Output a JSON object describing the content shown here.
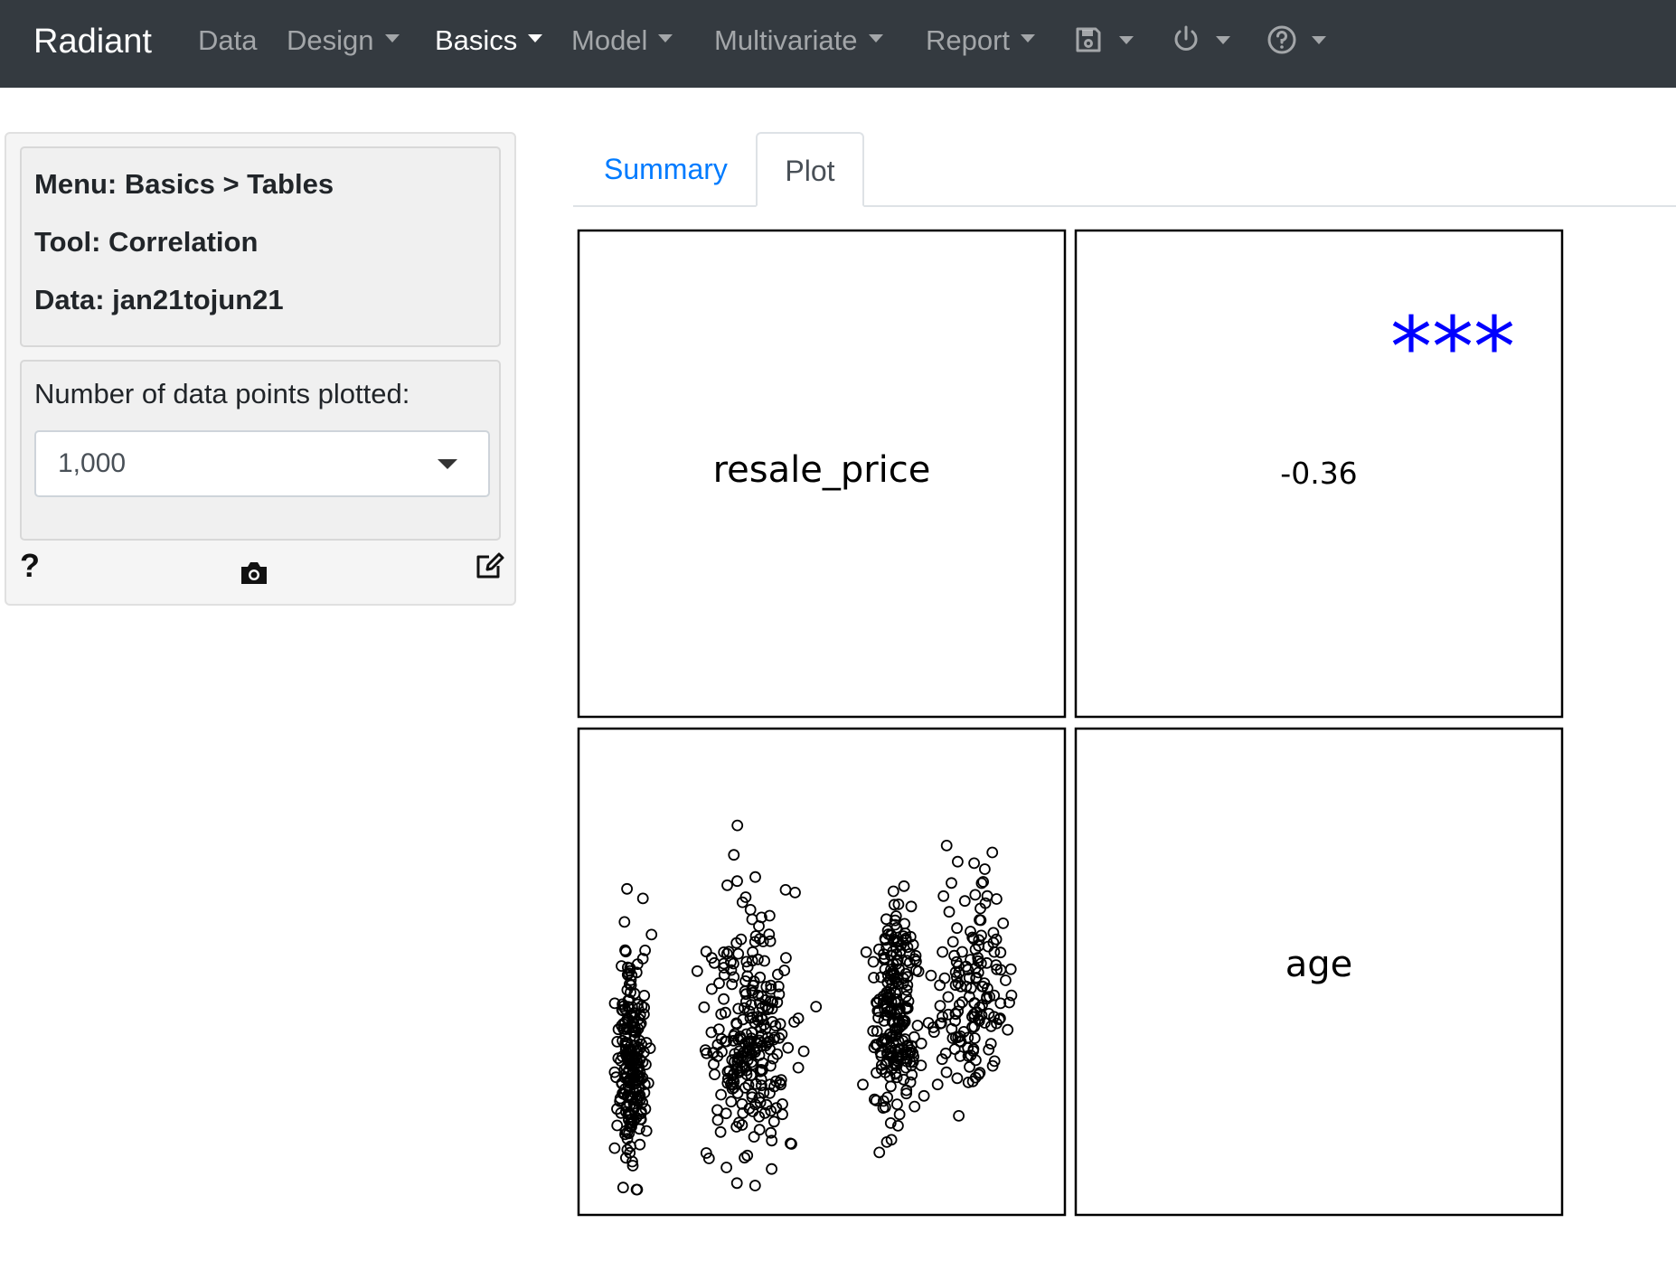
{
  "navbar": {
    "brand": "Radiant",
    "items": [
      {
        "label": "Data",
        "dropdown": false,
        "active": false
      },
      {
        "label": "Design",
        "dropdown": true,
        "active": false
      },
      {
        "label": "Basics",
        "dropdown": true,
        "active": true
      },
      {
        "label": "Model",
        "dropdown": true,
        "active": false
      },
      {
        "label": "Multivariate",
        "dropdown": true,
        "active": false
      },
      {
        "label": "Report",
        "dropdown": true,
        "active": false
      }
    ],
    "icons": [
      "save-icon",
      "power-icon",
      "help-circle-icon"
    ]
  },
  "sidebar": {
    "menu_line": "Menu: Basics > Tables",
    "tool_line": "Tool: Correlation",
    "data_line": "Data: jan21tojun21",
    "points_label": "Number of data points plotted:",
    "points_value": "1,000",
    "footer_icons": [
      "help-icon",
      "camera-icon",
      "edit-icon"
    ],
    "help_glyph": "?"
  },
  "tabs": {
    "items": [
      "Summary",
      "Plot"
    ],
    "active": "Plot"
  },
  "chart_data": {
    "type": "scatter",
    "layout": "correlation-matrix",
    "variables": [
      "resale_price",
      "age"
    ],
    "correlation": "-0.36",
    "significance": "***",
    "significance_color": "#0000ff",
    "clusters_age": [
      {
        "x_center": 0.08,
        "x_spread": 0.03,
        "count": 220
      },
      {
        "x_center": 0.34,
        "x_spread": 0.09,
        "count": 250
      },
      {
        "x_center": 0.66,
        "x_spread": 0.05,
        "count": 230
      },
      {
        "x_center": 0.83,
        "x_spread": 0.08,
        "count": 150
      }
    ]
  }
}
